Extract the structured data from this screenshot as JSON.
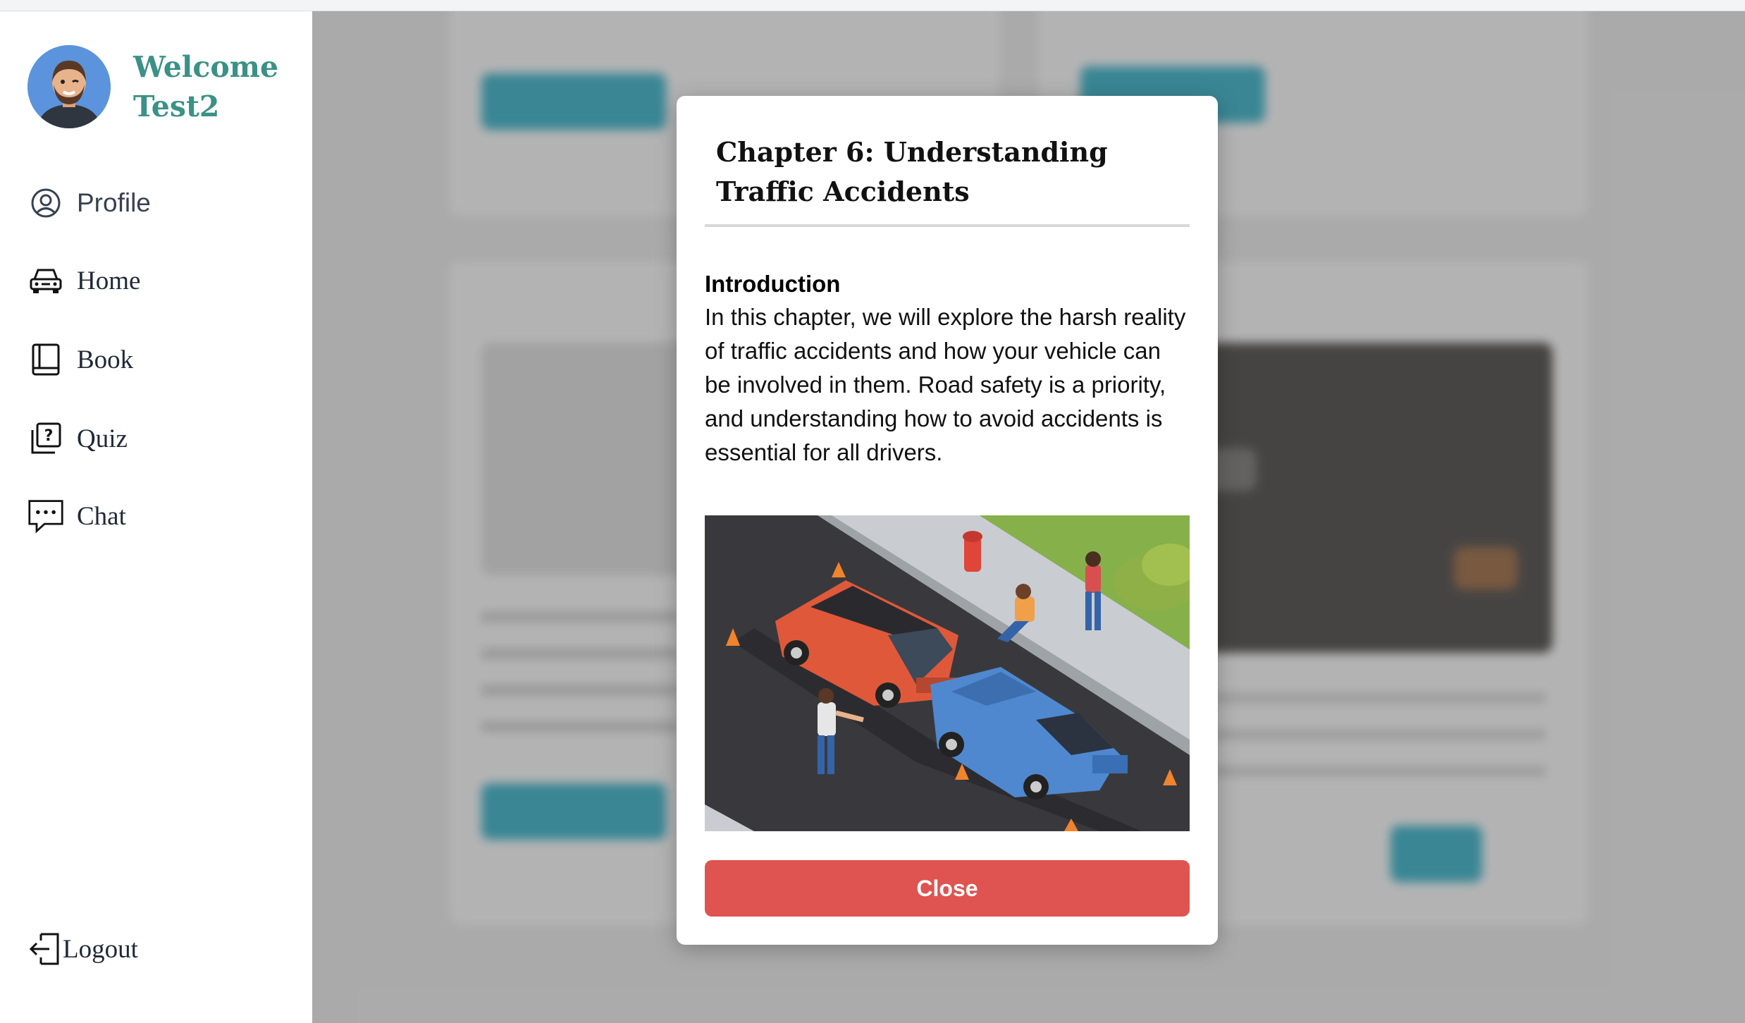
{
  "user": {
    "greeting": "Welcome",
    "name": "Test2"
  },
  "nav": {
    "profile": "Profile",
    "home": "Home",
    "book": "Book",
    "quiz": "Quiz",
    "chat": "Chat",
    "logout": "Logout"
  },
  "modal": {
    "title": "Chapter 6: Understanding Traffic Accidents",
    "section_heading": "Introduction",
    "section_body": "In this chapter, we will explore the harsh reality of traffic accidents and how your vehicle can be involved in them. Road safety is a priority, and understanding how to avoid accidents is essential for all drivers.",
    "close_label": "Close"
  },
  "colors": {
    "accent": "#3b9186",
    "close_button": "#df5450",
    "read_more": "#2a9fb5"
  },
  "icons": {
    "profile": "user-circle-icon",
    "home": "car-icon",
    "book": "book-icon",
    "quiz": "quiz-icon",
    "chat": "chat-bubble-icon",
    "logout": "logout-icon"
  }
}
